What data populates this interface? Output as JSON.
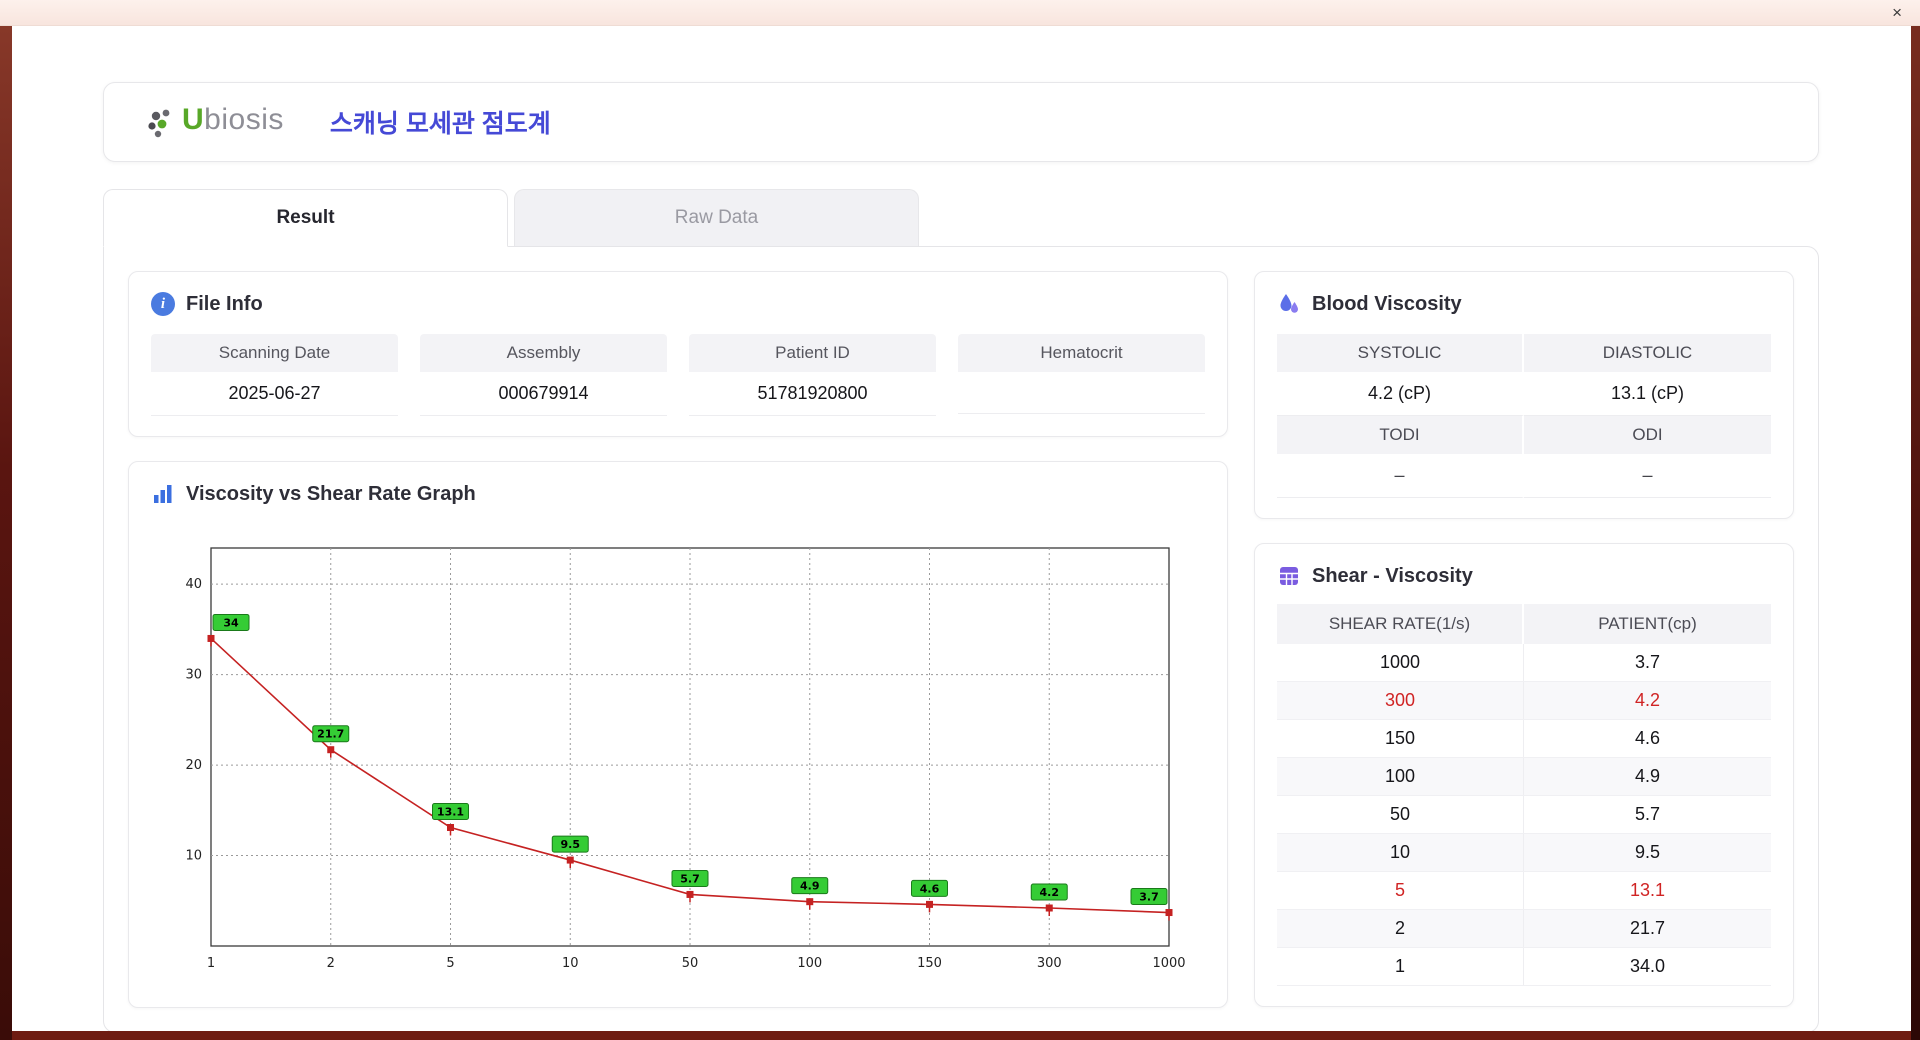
{
  "window": {
    "close_label": "×"
  },
  "header": {
    "brand_first": "U",
    "brand_rest": "biosis",
    "app_title": "스캐닝 모세관 점도계"
  },
  "tabs": [
    {
      "label": "Result",
      "active": true
    },
    {
      "label": "Raw Data",
      "active": false
    }
  ],
  "file_info": {
    "title": "File Info",
    "fields": [
      {
        "label": "Scanning Date",
        "value": "2025-06-27"
      },
      {
        "label": "Assembly",
        "value": "000679914"
      },
      {
        "label": "Patient ID",
        "value": "51781920800"
      },
      {
        "label": "Hematocrit",
        "value": ""
      }
    ]
  },
  "blood_viscosity": {
    "title": "Blood Viscosity",
    "systolic_label": "SYSTOLIC",
    "diastolic_label": "DIASTOLIC",
    "systolic_value": "4.2 (cP)",
    "diastolic_value": "13.1 (cP)",
    "todi_label": "TODI",
    "odi_label": "ODI",
    "todi_value": "–",
    "odi_value": "–"
  },
  "graph": {
    "title": "Viscosity vs Shear Rate Graph"
  },
  "chart_data": {
    "type": "line",
    "title": "Viscosity vs Shear Rate Graph",
    "categories": [
      "1",
      "2",
      "5",
      "10",
      "50",
      "100",
      "150",
      "300",
      "1000"
    ],
    "values": [
      34,
      21.7,
      13.1,
      9.5,
      5.7,
      4.9,
      4.6,
      4.2,
      3.7
    ],
    "labels": [
      "34",
      "21.7",
      "13.1",
      "9.5",
      "5.7",
      "4.9",
      "4.6",
      "4.2",
      "3.7"
    ],
    "xlabel": "",
    "ylabel": "",
    "ylim": [
      0,
      44
    ],
    "yticks": [
      10,
      20,
      30,
      40
    ],
    "grid": "dotted",
    "line_color": "#c52222",
    "label_bg": "#35cc35",
    "label_border": "#1a7a1a"
  },
  "shear_table": {
    "title": "Shear - Viscosity",
    "headers": [
      "SHEAR RATE(1/s)",
      "PATIENT(cp)"
    ],
    "rows": [
      {
        "shear": "1000",
        "patient": "3.7",
        "highlight": false
      },
      {
        "shear": "300",
        "patient": "4.2",
        "highlight": true
      },
      {
        "shear": "150",
        "patient": "4.6",
        "highlight": false
      },
      {
        "shear": "100",
        "patient": "4.9",
        "highlight": false
      },
      {
        "shear": "50",
        "patient": "5.7",
        "highlight": false
      },
      {
        "shear": "10",
        "patient": "9.5",
        "highlight": false
      },
      {
        "shear": "5",
        "patient": "13.1",
        "highlight": true
      },
      {
        "shear": "2",
        "patient": "21.7",
        "highlight": false
      },
      {
        "shear": "1",
        "patient": "34.0",
        "highlight": false
      }
    ]
  }
}
